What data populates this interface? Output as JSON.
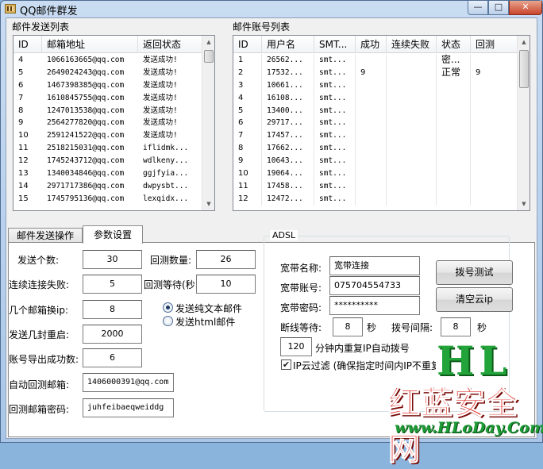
{
  "window": {
    "title": "QQ邮件群发",
    "buttons": {
      "minimize": "—",
      "maximize": "□",
      "close": "✕"
    }
  },
  "send_list": {
    "group_title": "邮件发送列表",
    "columns": [
      "ID",
      "邮箱地址",
      "返回状态"
    ],
    "rows": [
      [
        "4",
        "1066163665@qq.com",
        "发送成功!"
      ],
      [
        "5",
        "2649024243@qq.com",
        "发送成功!"
      ],
      [
        "6",
        "1467398385@qq.com",
        "发送成功!"
      ],
      [
        "7",
        "1610845755@qq.com",
        "发送成功!"
      ],
      [
        "8",
        "1247013538@qq.com",
        "发送成功!"
      ],
      [
        "9",
        "2564277820@qq.com",
        "发送成功!"
      ],
      [
        "10",
        "2591241522@qq.com",
        "发送成功!"
      ],
      [
        "11",
        "2518215031@qq.com",
        "iflidmk..."
      ],
      [
        "12",
        "1745243712@qq.com",
        "wdlkeny..."
      ],
      [
        "13",
        "1340034846@qq.com",
        "ggjfyia..."
      ],
      [
        "14",
        "2971717386@qq.com",
        "dwpysbt..."
      ],
      [
        "15",
        "1745795136@qq.com",
        "lexqidx..."
      ]
    ]
  },
  "account_list": {
    "group_title": "邮件账号列表",
    "columns": [
      "ID",
      "用户名",
      "SMT...",
      "成功",
      "连续失败",
      "状态",
      "回测"
    ],
    "rows": [
      [
        "1",
        "26562...",
        "smt...",
        "",
        "",
        "密...",
        ""
      ],
      [
        "2",
        "17532...",
        "smt...",
        "9",
        "",
        "正常",
        "9"
      ],
      [
        "3",
        "10661...",
        "smt...",
        "",
        "",
        "",
        ""
      ],
      [
        "4",
        "16108...",
        "smt...",
        "",
        "",
        "",
        ""
      ],
      [
        "5",
        "13400...",
        "smt...",
        "",
        "",
        "",
        ""
      ],
      [
        "6",
        "29717...",
        "smt...",
        "",
        "",
        "",
        ""
      ],
      [
        "7",
        "17457...",
        "smt...",
        "",
        "",
        "",
        ""
      ],
      [
        "8",
        "17662...",
        "smt...",
        "",
        "",
        "",
        ""
      ],
      [
        "9",
        "10643...",
        "smt...",
        "",
        "",
        "",
        ""
      ],
      [
        "10",
        "19064...",
        "smt...",
        "",
        "",
        "",
        ""
      ],
      [
        "11",
        "17458...",
        "smt...",
        "",
        "",
        "",
        ""
      ],
      [
        "12",
        "12472...",
        "smt...",
        "",
        "",
        "",
        ""
      ]
    ]
  },
  "tabs": [
    {
      "label": "邮件发送操作"
    },
    {
      "label": "参数设置"
    }
  ],
  "params": {
    "send_count": {
      "label": "发送个数:",
      "value": "30"
    },
    "consecutive_fail": {
      "label": "连续连接失败:",
      "value": "5"
    },
    "switch_ip": {
      "label": "几个邮箱换ip:",
      "value": "8"
    },
    "restart_after": {
      "label": "发送几封重启:",
      "value": "2000"
    },
    "export_success": {
      "label": "账号导出成功数:",
      "value": "6"
    },
    "auto_reply_mailbox": {
      "label": "自动回测邮箱:",
      "value": "1406000391@qq.com"
    },
    "reply_mailbox_password": {
      "label": "回测邮箱密码:",
      "value": "juhfeibaeqweiddg"
    },
    "reply_count": {
      "label": "回测数量:",
      "value": "26"
    },
    "reply_wait": {
      "label": "回测等待(秒",
      "value": "10"
    },
    "radio_text": {
      "label": "发送纯文本邮件",
      "selected": true
    },
    "radio_html": {
      "label": "发送html邮件",
      "selected": false
    }
  },
  "adsl": {
    "legend": "ADSL",
    "broadband_name": {
      "label": "宽带名称:",
      "value": "宽带连接"
    },
    "broadband_account": {
      "label": "宽带账号:",
      "value": "075704554733"
    },
    "broadband_password": {
      "label": "宽带密码:",
      "value": "**********"
    },
    "disconnect_wait": {
      "label": "断线等待:",
      "value": "8",
      "unit": "秒"
    },
    "dial_interval": {
      "label": "拨号间隔:",
      "value": "8",
      "unit": "秒"
    },
    "repeat_minutes": {
      "value": "120",
      "label": "分钟内重复IP自动拨号"
    },
    "ip_cloud_filter": {
      "label": "IP云过滤 (确保指定时间内IP不重复",
      "checked": true
    },
    "dial_test_button": "拨号测试",
    "clear_cloud_ip_button": "清空云ip"
  },
  "watermark": {
    "logo_letters": "HL",
    "site_name": "红蓝安全网",
    "url": "www.HLoDay.Com"
  }
}
